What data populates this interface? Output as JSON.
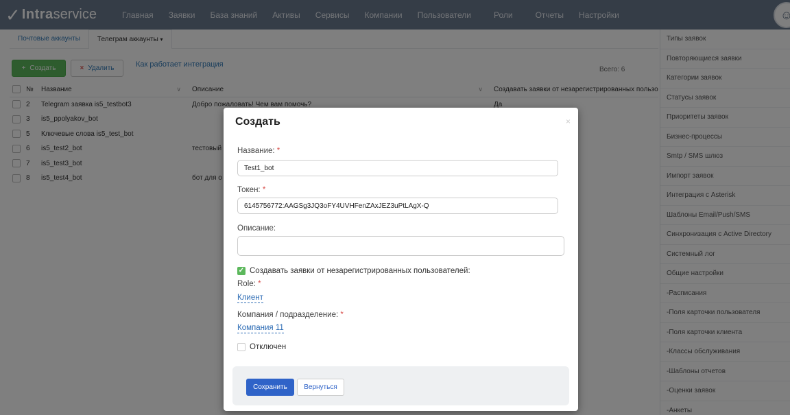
{
  "brand": {
    "name_bold": "Intra",
    "name_regular": "service"
  },
  "nav": [
    "Главная",
    "Заявки",
    "База знаний",
    "Активы",
    "Сервисы",
    "Компании",
    "Пользователи",
    "Роли",
    "Отчеты",
    "Настройки"
  ],
  "subtabs": {
    "mail": "Почтовые аккаунты",
    "telegram": "Телеграм аккаунты",
    "caret": "▾"
  },
  "toolbar": {
    "create": "Создать",
    "delete": "Удалить",
    "howto": "Как работает интеграция",
    "total": "Всего: 6"
  },
  "table": {
    "headers": {
      "num": "№",
      "name": "Название",
      "desc": "Описание",
      "create": "Создавать заявки от незарегистрированных пользователей"
    },
    "rows": [
      {
        "num": "2",
        "name": "Telegram заявка is5_testbot3",
        "desc": "Добро пожаловать! Чем вам помочь?",
        "create": "Да"
      },
      {
        "num": "3",
        "name": "is5_ppolyakov_bot",
        "desc": "",
        "create": ""
      },
      {
        "num": "5",
        "name": "Ключевые слова is5_test_bot",
        "desc": "",
        "create": ""
      },
      {
        "num": "6",
        "name": "is5_test2_bot",
        "desc": "тестовый",
        "create": ""
      },
      {
        "num": "7",
        "name": "is5_test3_bot",
        "desc": "",
        "create": ""
      },
      {
        "num": "8",
        "name": "is5_test4_bot",
        "desc": "бот для о",
        "create": ""
      }
    ]
  },
  "sidebar": [
    "Типы заявок",
    "Повторяющиеся заявки",
    "Категории заявок",
    "Статусы заявок",
    "Приоритеты заявок",
    "Бизнес-процессы",
    "Smtp / SMS шлюз",
    "Импорт заявок",
    "Интеграция с Asterisk",
    "Шаблоны Email/Push/SMS",
    "Синхронизация с Active Directory",
    "Системный лог",
    "Общие настройки",
    "-Расписания",
    "-Поля карточки пользователя",
    "-Поля карточки клиента",
    "-Классы обслуживания",
    "-Шаблоны отчетов",
    "-Оценки заявок",
    "-Анкеты"
  ],
  "modal": {
    "title": "Создать",
    "close": "×",
    "name_label": "Название:",
    "name_value": "Test1_bot",
    "token_label": "Токен:",
    "token_value": "6145756772:AAGSg3JQ3oFY4UVHFenZAxJEZ3uPtLAgX-Q",
    "desc_label": "Описание:",
    "desc_value": "",
    "create_unreg_label": "Создавать заявки от незарегистрированных пользователей:",
    "create_unreg_checked": true,
    "role_label": "Role:",
    "role_value": "Клиент",
    "company_label": "Компания / подразделение:",
    "company_value": "Компания 11",
    "disabled_label": "Отключен",
    "disabled_checked": false,
    "required_mark": "*",
    "save": "Сохранить",
    "back": "Вернуться"
  }
}
